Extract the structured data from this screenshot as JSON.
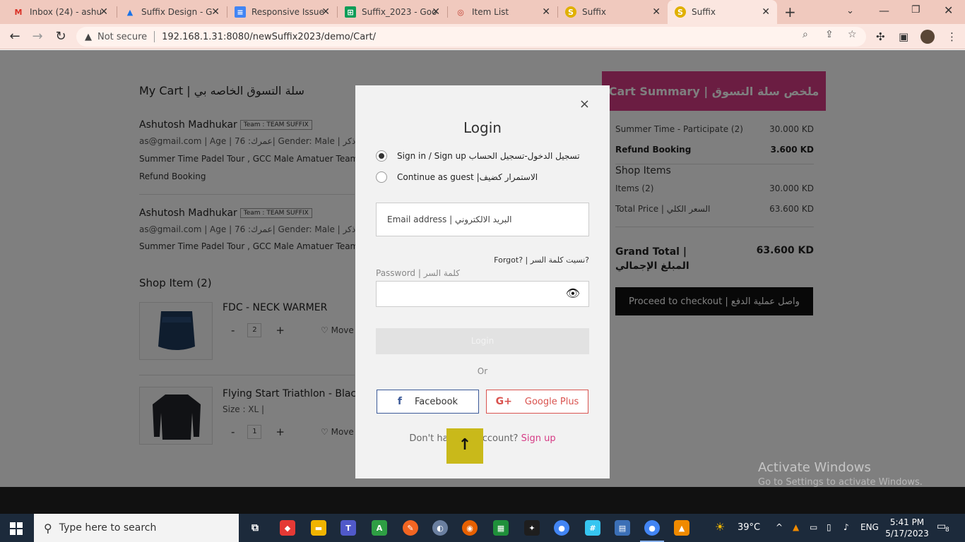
{
  "browser": {
    "tabs": [
      {
        "label": "Inbox (24) - ashu",
        "icon": "M",
        "icon_color": "#d93025"
      },
      {
        "label": "Suffix Design - G",
        "icon": "▲",
        "icon_color": "#1a73e8"
      },
      {
        "label": "Responsive Issue",
        "icon": "≡",
        "icon_color": "#4285f4"
      },
      {
        "label": "Suffix_2023 - Goo",
        "icon": "⊞",
        "icon_color": "#0f9d58"
      },
      {
        "label": "Item List",
        "icon": "◎",
        "icon_color": "#c0392b"
      },
      {
        "label": "Suffix",
        "icon": "S",
        "icon_color": "#e0b000"
      },
      {
        "label": "Suffix",
        "icon": "S",
        "icon_color": "#e0b000"
      }
    ],
    "new_tab": "+",
    "not_secure": "Not secure",
    "url": "192.168.1.31:8080/newSuffix2023/demo/Cart/"
  },
  "cart": {
    "title": "My Cart | سلة التسوق الخاصه بي",
    "participants": [
      {
        "name": "Ashutosh Madhukar",
        "team": "Team : TEAM SUFFIX",
        "meta": "as@gmail.com | Age | عمرك: 76| Gender: Male | ذكر | Size : M",
        "event": "Summer Time Padel Tour , GCC Male Amatuer Team",
        "extra": "Refund Booking"
      },
      {
        "name": "Ashutosh Madhukar",
        "team": "Team : TEAM SUFFIX",
        "meta": "as@gmail.com | Age | عمرك: 76| Gender: Male | ذكر | Size : M",
        "event": "Summer Time Padel Tour , GCC Male Amatuer Team",
        "extra": ""
      }
    ],
    "shop_heading": "Shop Item (2)",
    "products": [
      {
        "name": "FDC - NECK WARMER",
        "size": "",
        "qty": "2",
        "move": "Move"
      },
      {
        "name": "Flying Start Triathlon - Black",
        "size": "Size : XL |",
        "qty": "1",
        "move": "Move"
      }
    ],
    "minus": "-",
    "plus": "+"
  },
  "summary": {
    "title": "Cart Summary | ملخص سلة التسوق",
    "rows": [
      {
        "label": "Summer Time - Participate (2)",
        "value": "30.000 KD"
      },
      {
        "label": "Refund Booking",
        "value": "3.600 KD"
      }
    ],
    "shop_items_label": "Shop Items",
    "items_row": {
      "label": "Items (2)",
      "value": "30.000 KD"
    },
    "total_row": {
      "label": "Total Price | السعر الكلي",
      "value": "63.600 KD"
    },
    "grand_label": "Grand Total | المبلغ الإجمالي",
    "grand_value": "63.600 KD",
    "checkout": "Proceed to checkout | واصل عملية الدفع",
    "brand_color": "#d63b85"
  },
  "modal": {
    "close": "×",
    "title": "Login",
    "option_signin": "Sign in / Sign up تسجيل الدخول-تسجيل الحساب",
    "option_guest": "Continue as guest |الاستمرار كضيف",
    "email_placeholder": "Email address | البريد الالكتروني",
    "forgot": "Forgot? | نسيت كلمة السر?",
    "password_label": "Password | كلمة السر",
    "login_button": "Login",
    "or": "Or",
    "facebook": "Facebook",
    "google": "Google Plus",
    "no_account": "Don't have an account?",
    "signup": "Sign up"
  },
  "windows": {
    "activate_title": "Activate Windows",
    "activate_sub": "Go to Settings to activate Windows.",
    "search_placeholder": "Type here to search",
    "weather": "39°C",
    "lang": "ENG",
    "time": "5:41 PM",
    "date": "5/17/2023",
    "notif_count": "8"
  }
}
